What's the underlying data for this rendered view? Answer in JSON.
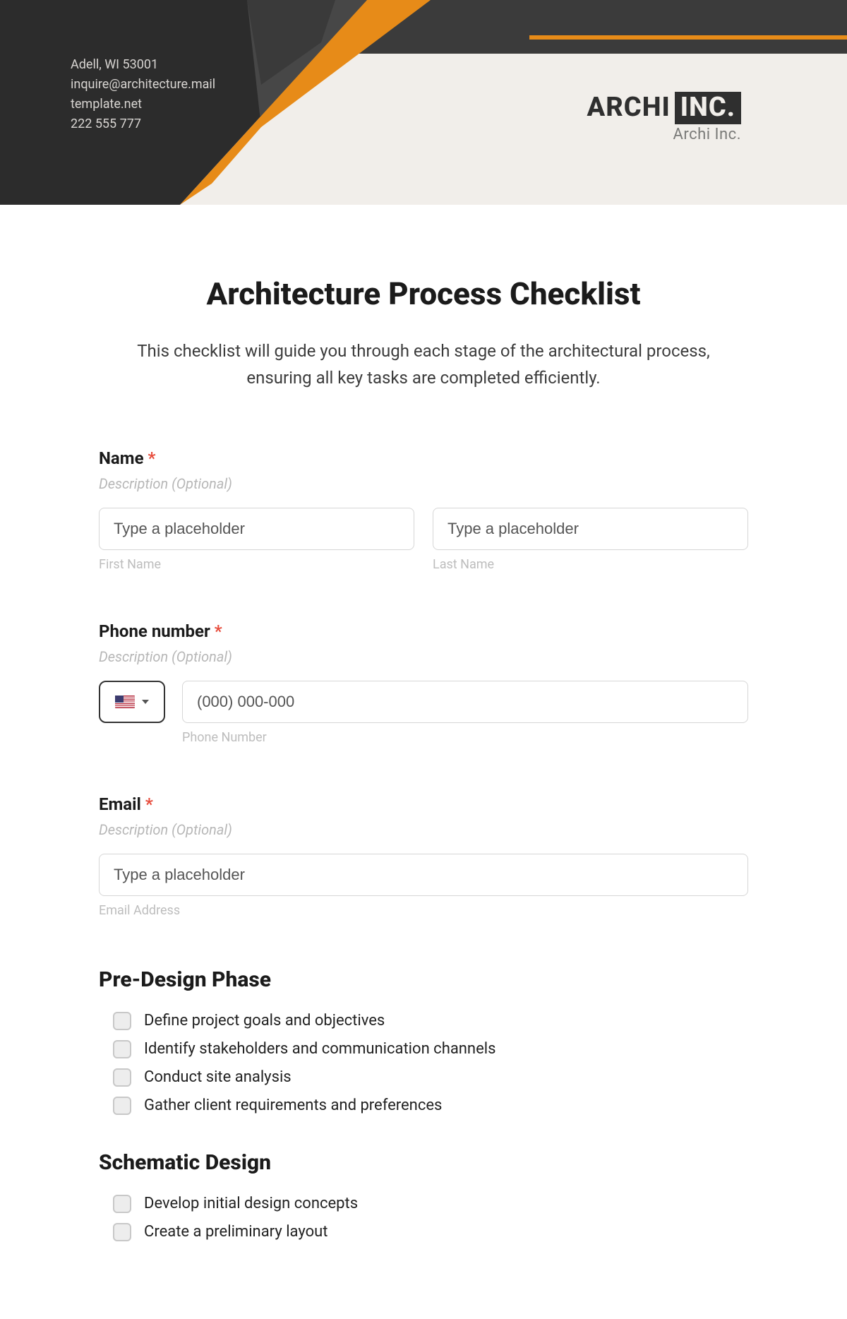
{
  "header": {
    "contact": {
      "address": "Adell, WI 53001",
      "email": "inquire@architecture.mail",
      "website": "template.net",
      "phone": "222 555 777"
    },
    "logo": {
      "word1": "ARCHI",
      "word2": "INC.",
      "subtitle": "Archi Inc."
    }
  },
  "page": {
    "title": "Architecture Process Checklist",
    "description": "This checklist will guide you through each stage of the architectural process, ensuring all key tasks are completed efficiently."
  },
  "fields": {
    "name": {
      "label": "Name",
      "required": "*",
      "desc": "Description (Optional)",
      "first_placeholder": "Type a placeholder",
      "last_placeholder": "Type a placeholder",
      "first_sub": "First Name",
      "last_sub": "Last Name"
    },
    "phone": {
      "label": "Phone number",
      "required": "*",
      "desc": "Description (Optional)",
      "placeholder": "(000) 000-000",
      "sub": "Phone Number"
    },
    "email": {
      "label": "Email",
      "required": "*",
      "desc": "Description (Optional)",
      "placeholder": "Type a placeholder",
      "sub": "Email Address"
    }
  },
  "sections": [
    {
      "title": "Pre-Design Phase",
      "items": [
        "Define project goals and objectives",
        "Identify stakeholders and communication channels",
        "Conduct site analysis",
        "Gather client requirements and preferences"
      ]
    },
    {
      "title": "Schematic Design",
      "items": [
        "Develop initial design concepts",
        "Create a preliminary layout"
      ]
    }
  ]
}
